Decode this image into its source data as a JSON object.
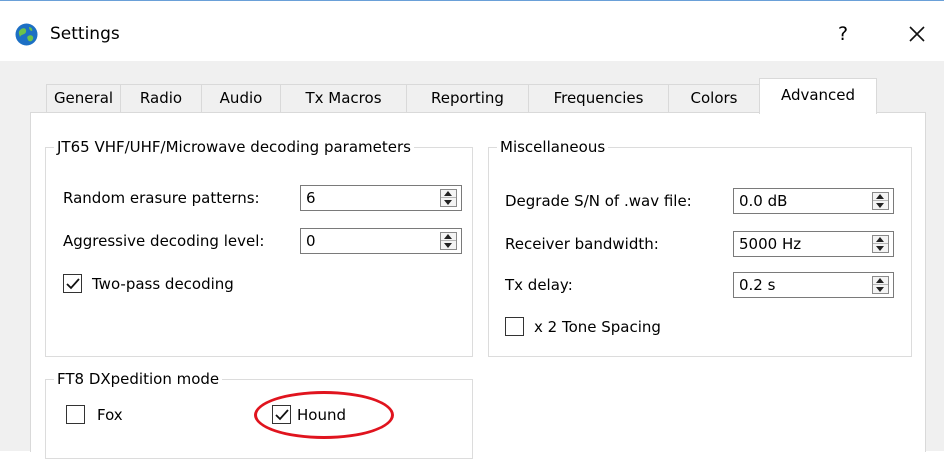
{
  "window": {
    "title": "Settings",
    "help_label": "?"
  },
  "tabs": [
    {
      "label": "General"
    },
    {
      "label": "Radio"
    },
    {
      "label": "Audio"
    },
    {
      "label": "Tx Macros"
    },
    {
      "label": "Reporting"
    },
    {
      "label": "Frequencies"
    },
    {
      "label": "Colors"
    },
    {
      "label": "Advanced",
      "active": true
    }
  ],
  "jt65": {
    "title": "JT65 VHF/UHF/Microwave decoding parameters",
    "random_erasure_label": "Random erasure patterns:",
    "random_erasure_value": "6",
    "aggressive_label": "Aggressive decoding level:",
    "aggressive_value": "0",
    "two_pass_label": "Two-pass decoding",
    "two_pass_checked": true
  },
  "misc": {
    "title": "Miscellaneous",
    "degrade_label": "Degrade S/N of .wav file:",
    "degrade_value": "0.0 dB",
    "bandwidth_label": "Receiver bandwidth:",
    "bandwidth_value": "5000  Hz",
    "tx_delay_label": "Tx delay:",
    "tx_delay_value": "0.2  s",
    "tone_spacing_label": "x 2 Tone Spacing",
    "tone_spacing_checked": false
  },
  "ft8": {
    "title": "FT8 DXpedition mode",
    "fox_label": "Fox",
    "fox_checked": false,
    "hound_label": "Hound",
    "hound_checked": true
  },
  "colors": {
    "annotation": "#e0141e",
    "title_accent": "#6aa0d8"
  },
  "icons": {
    "app": "globe-icon",
    "close": "close-icon",
    "check": "checkmark-icon",
    "spin": "spin-arrows-icon"
  }
}
